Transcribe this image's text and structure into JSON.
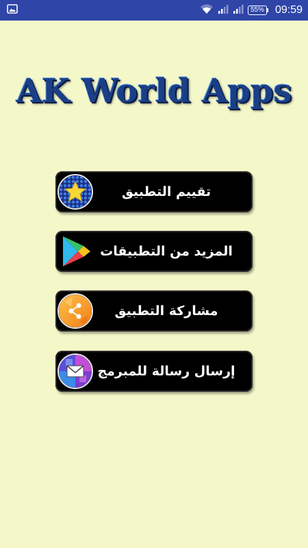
{
  "status_bar": {
    "time": "09:59",
    "battery": "55%",
    "icons": [
      "image-notification-icon",
      "wifi-icon",
      "signal-icon",
      "signal-icon",
      "battery-icon"
    ]
  },
  "title": "AK World Apps",
  "menu": {
    "items": [
      {
        "label": "تقييم التطبيق",
        "icon": "star-badge-icon"
      },
      {
        "label": "المزيد من التطبيقات",
        "icon": "play-store-icon"
      },
      {
        "label": "مشاركة التطبيق",
        "icon": "share-icon"
      },
      {
        "label": "إرسال رسالة للمبرمج",
        "icon": "mail-icon"
      }
    ]
  },
  "colors": {
    "background": "#f4f8c9",
    "status_bar": "#2f45a8",
    "title": "#1b3f86",
    "button": "#000000"
  }
}
